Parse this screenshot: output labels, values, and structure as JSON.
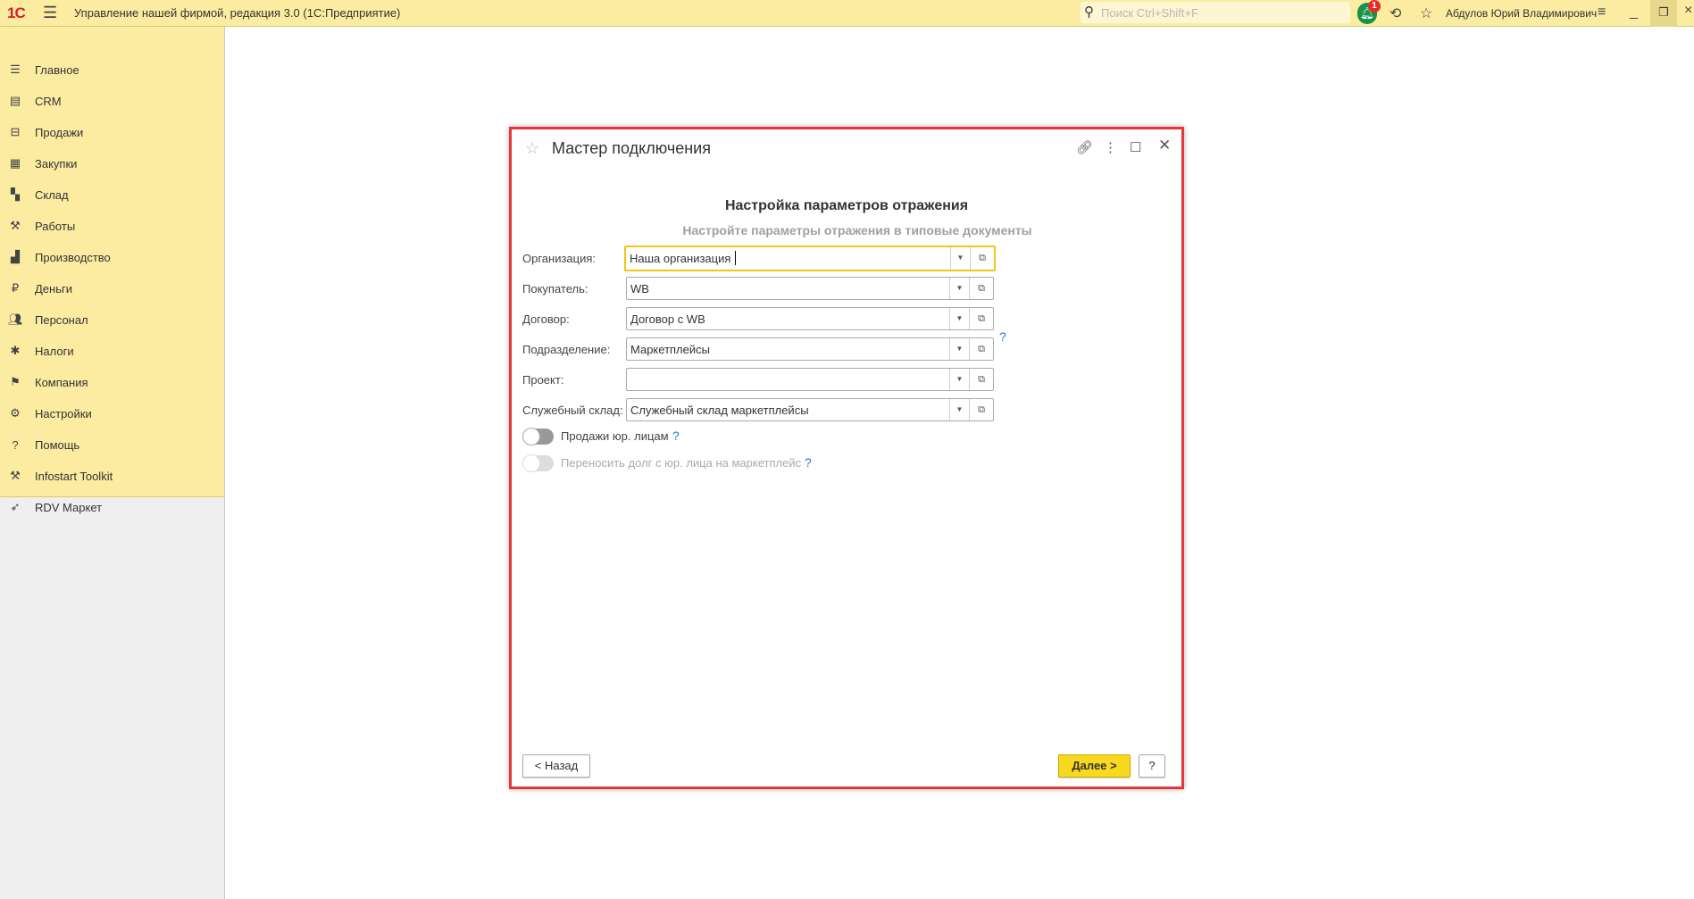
{
  "app": {
    "logo": "1С",
    "title": "Управление нашей фирмой, редакция 3.0  (1С:Предприятие)",
    "search_placeholder": "Поиск Ctrl+Shift+F",
    "notifications_count": "1",
    "user": "Абдулов Юрий Владимирович"
  },
  "sidebar": {
    "items": [
      {
        "label": "Главное",
        "icon": "menu-icon"
      },
      {
        "label": "CRM",
        "icon": "crm-icon"
      },
      {
        "label": "Продажи",
        "icon": "basket-icon"
      },
      {
        "label": "Закупки",
        "icon": "purchases-icon"
      },
      {
        "label": "Склад",
        "icon": "warehouse-icon"
      },
      {
        "label": "Работы",
        "icon": "tools-icon"
      },
      {
        "label": "Производство",
        "icon": "factory-icon"
      },
      {
        "label": "Деньги",
        "icon": "ruble-icon"
      },
      {
        "label": "Персонал",
        "icon": "people-icon"
      },
      {
        "label": "Налоги",
        "icon": "emblem-icon"
      },
      {
        "label": "Компания",
        "icon": "flag-icon"
      },
      {
        "label": "Настройки",
        "icon": "gear-icon"
      },
      {
        "label": "Помощь",
        "icon": "help-icon"
      },
      {
        "label": "Infostart Toolkit",
        "icon": "toolkit-icon"
      },
      {
        "label": "RDV Маркет",
        "icon": "rocket-icon"
      }
    ]
  },
  "dialog": {
    "title": "Мастер подключения",
    "heading": "Настройка параметров отражения",
    "subheading": "Настройте параметры отражения в типовые документы",
    "fields": [
      {
        "label": "Организация:",
        "value": "Наша организация"
      },
      {
        "label": "Покупатель:",
        "value": "WB"
      },
      {
        "label": "Договор:",
        "value": "Договор с WB"
      },
      {
        "label": "Подразделение:",
        "value": "Маркетплейсы"
      },
      {
        "label": "Проект:",
        "value": ""
      },
      {
        "label": "Служебный склад:",
        "value": "Служебный склад маркетплейсы"
      }
    ],
    "toggles": [
      {
        "label": "Продажи юр. лицам",
        "on": false,
        "enabled": true
      },
      {
        "label": "Переносить долг с юр. лица на маркетплейс",
        "on": false,
        "enabled": false
      }
    ],
    "help_mark": "?",
    "back_label": "< Назад",
    "next_label": "Далее >",
    "help_label": "?"
  }
}
